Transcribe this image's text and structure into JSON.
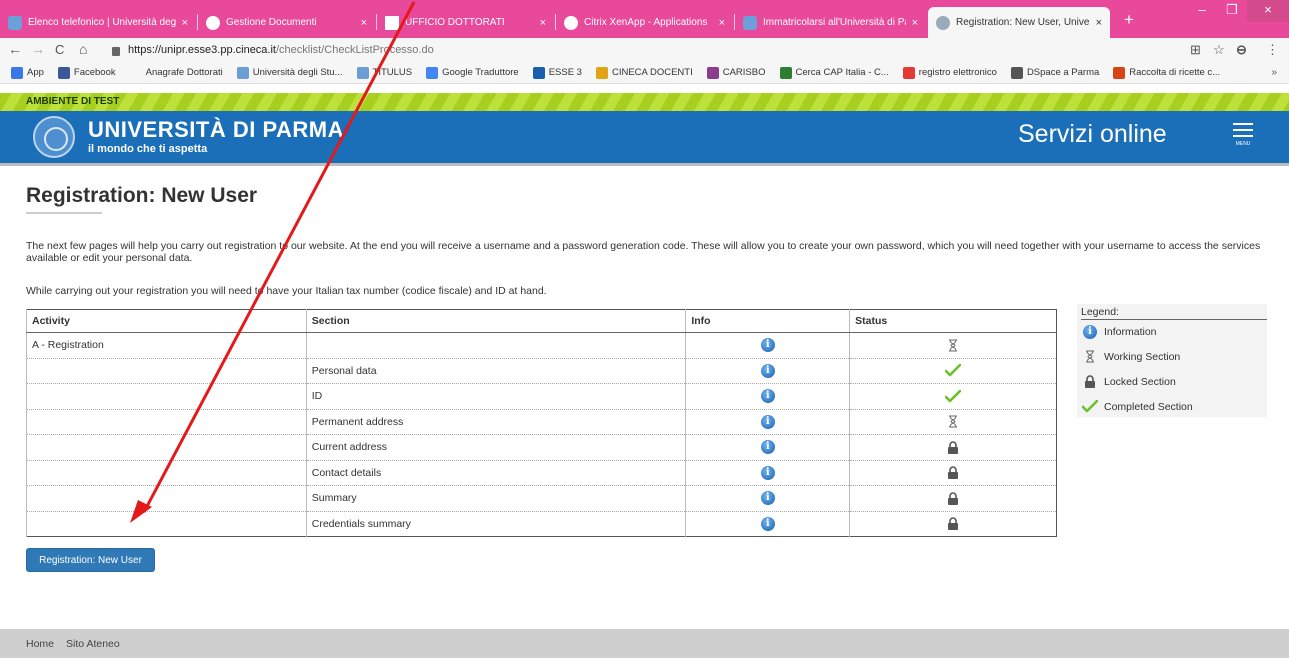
{
  "browser": {
    "tabs": [
      {
        "label": "Elenco telefonico | Università deg",
        "close": "×"
      },
      {
        "label": "Gestione Documenti",
        "close": "×"
      },
      {
        "label": "UFFICIO DOTTORATI",
        "close": "×"
      },
      {
        "label": "Citrix XenApp - Applications",
        "close": "×"
      },
      {
        "label": "Immatricolarsi all'Università di Pa",
        "close": "×"
      },
      {
        "label": "Registration: New User, Universit",
        "close": "×"
      }
    ],
    "new_tab": "+",
    "window_controls": {
      "minimize": "–",
      "maximize": "❐",
      "close": "×"
    },
    "nav": {
      "back": "←",
      "forward": "→",
      "reload": "C",
      "home": "⌂"
    },
    "url_host": "https://unipr.esse3.pp.cineca.it",
    "url_path": "/checklist/CheckListProcesso.do",
    "address_icons": {
      "translate": "⊞",
      "star": "☆",
      "profile": "⊖",
      "menu": "⋮"
    },
    "bookmarks": [
      {
        "label": "App",
        "color": "#3b78e7"
      },
      {
        "label": "Facebook",
        "color": "#3b5998"
      },
      {
        "label": "Anagrafe Dottorati",
        "color": "#f6f6f6"
      },
      {
        "label": "Università degli Stu...",
        "color": "#6b9fd4"
      },
      {
        "label": "TITULUS",
        "color": "#6b9fd4"
      },
      {
        "label": "Google Traduttore",
        "color": "#4285f4"
      },
      {
        "label": "ESSE 3",
        "color": "#1a5fae"
      },
      {
        "label": "CINECA DOCENTI",
        "color": "#e2a414"
      },
      {
        "label": "CARISBO",
        "color": "#8a3d8d"
      },
      {
        "label": "Cerca CAP Italia - C...",
        "color": "#2e7d32"
      },
      {
        "label": "registro elettronico",
        "color": "#e53935"
      },
      {
        "label": "DSpace a Parma",
        "color": "#555555"
      },
      {
        "label": "Raccolta di ricette c...",
        "color": "#d84315"
      }
    ],
    "bookmarks_more": "»"
  },
  "banner": {
    "test_env": "AMBIENTE DI TEST"
  },
  "header": {
    "university": "UNIVERSITÀ DI PARMA",
    "tagline": "il mondo che ti aspetta",
    "services": "Servizi online",
    "menu_label": "MENU"
  },
  "main": {
    "title": "Registration: New User",
    "intro": "The next few pages will help you carry out registration to our website. At the end you will receive a username and a password generation code. These will allow you to create your own password, which you will need together with your username to access the services available or edit your personal data.",
    "intro2": "While carrying out your registration you will need to have your Italian tax number (codice fiscale) and ID at hand.",
    "table": {
      "headers": {
        "activity": "Activity",
        "section": "Section",
        "info": "Info",
        "status": "Status"
      },
      "rows": [
        {
          "activity": "A - Registration",
          "section": "",
          "status": "working"
        },
        {
          "activity": "",
          "section": "Personal data",
          "status": "completed"
        },
        {
          "activity": "",
          "section": "ID",
          "status": "completed"
        },
        {
          "activity": "",
          "section": "Permanent address",
          "status": "working"
        },
        {
          "activity": "",
          "section": "Current address",
          "status": "locked"
        },
        {
          "activity": "",
          "section": "Contact details",
          "status": "locked"
        },
        {
          "activity": "",
          "section": "Summary",
          "status": "locked"
        },
        {
          "activity": "",
          "section": "Credentials summary",
          "status": "locked"
        }
      ]
    },
    "legend": {
      "title": "Legend:",
      "information": "Information",
      "working": "Working Section",
      "locked": "Locked Section",
      "completed": "Completed Section"
    },
    "button_label": "Registration: New User"
  },
  "footer": {
    "home": "Home",
    "sito": "Sito Ateneo"
  },
  "colors": {
    "tabstrip": "#e8499a",
    "header": "#1a6fb8",
    "test_banner": "#a6cf1f",
    "button": "#2f79b7",
    "annotation_arrow": "#e41a1a"
  }
}
